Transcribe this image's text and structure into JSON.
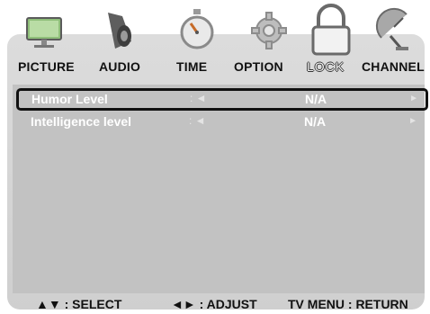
{
  "tabs": [
    {
      "label": "PICTURE",
      "icon": "monitor-icon"
    },
    {
      "label": "AUDIO",
      "icon": "speaker-icon"
    },
    {
      "label": "TIME",
      "icon": "stopwatch-icon"
    },
    {
      "label": "OPTION",
      "icon": "gear-icon"
    },
    {
      "label": "LOCK",
      "icon": "padlock-icon",
      "active": true
    },
    {
      "label": "CHANNEL",
      "icon": "satellite-dish-icon"
    }
  ],
  "rows": [
    {
      "label": "Humor Level",
      "separator": ": ◄",
      "value": "N/A",
      "right_arrow": "►",
      "selected": true
    },
    {
      "label": "Intelligence level",
      "separator": ": ◄",
      "value": "N/A",
      "right_arrow": "►",
      "selected": false
    }
  ],
  "footer": {
    "select": "▲▼ : SELECT",
    "adjust": "◄► : ADJUST",
    "return": "TV MENU : RETURN"
  },
  "colors": {
    "panel": "#d6d6d6",
    "content": "#c2c2c2",
    "selection_border": "#111111"
  }
}
